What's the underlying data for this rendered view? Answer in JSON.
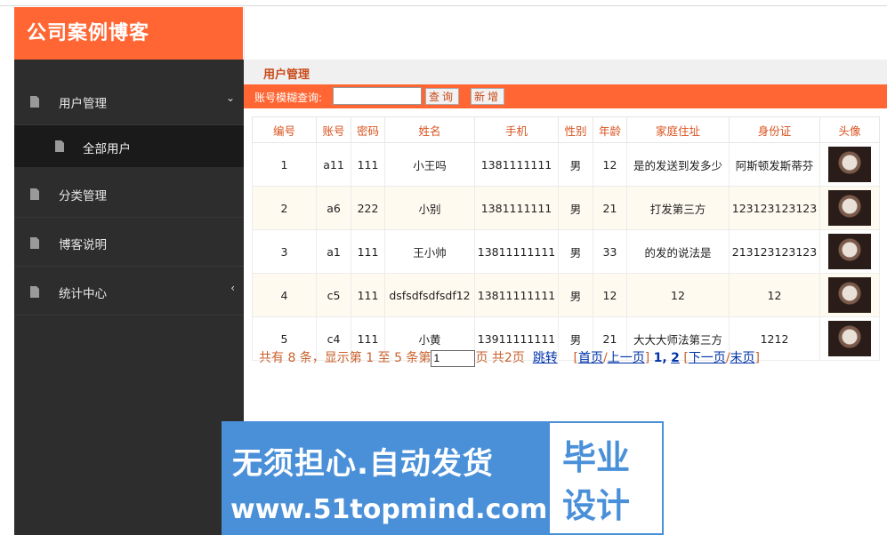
{
  "brand": "公司案例博客",
  "sidebar": {
    "items": [
      {
        "label": "用户管理",
        "chevron": "⌄"
      },
      {
        "label": "分类管理"
      },
      {
        "label": "博客说明"
      },
      {
        "label": "统计中心",
        "chevron": "‹"
      }
    ],
    "sub_item": "全部用户"
  },
  "breadcrumb": "用户管理",
  "search": {
    "label": "账号模糊查询:",
    "value": "",
    "query_button": "查询",
    "new_button": "新增"
  },
  "table": {
    "headers": [
      "编号",
      "账号",
      "密码",
      "姓名",
      "手机",
      "性别",
      "年龄",
      "家庭住址",
      "身份证",
      "头像"
    ],
    "rows": [
      [
        "1",
        "a11",
        "111",
        "小王吗",
        "1381111111",
        "男",
        "12",
        "是的发送到发多少",
        "阿斯顿发斯蒂芬"
      ],
      [
        "2",
        "a6",
        "222",
        "小别",
        "1381111111",
        "男",
        "21",
        "打发第三方",
        "123123123123"
      ],
      [
        "3",
        "a1",
        "111",
        "王小帅",
        "13811111111",
        "男",
        "33",
        "的发的说法是",
        "213123123123"
      ],
      [
        "4",
        "c5",
        "111",
        "dsfsdfsdfsdf12",
        "13811111111",
        "男",
        "12",
        "12",
        "12"
      ],
      [
        "5",
        "c4",
        "111",
        "小黄",
        "13911111111",
        "男",
        "21",
        "大大大师法第三方",
        "1212"
      ]
    ]
  },
  "pager": {
    "summary": "共有 8 条，显示第 1 至 5 条第",
    "page_value": "1",
    "total": "页 共2页",
    "jump": "跳转",
    "open_bracket": "[",
    "first": "首页",
    "slash1": "/",
    "prev": "上一页",
    "close_bracket": "]",
    "page1": "1,",
    "page2": "2",
    "open_bracket2": "[",
    "next": "下一页",
    "slash2": "/",
    "last": "末页",
    "close_bracket2": "]"
  },
  "watermark": {
    "line1": "无须担心.自动发货",
    "line2": "www.51topmind.com",
    "box_line1": "毕业",
    "box_line2": "设计"
  }
}
